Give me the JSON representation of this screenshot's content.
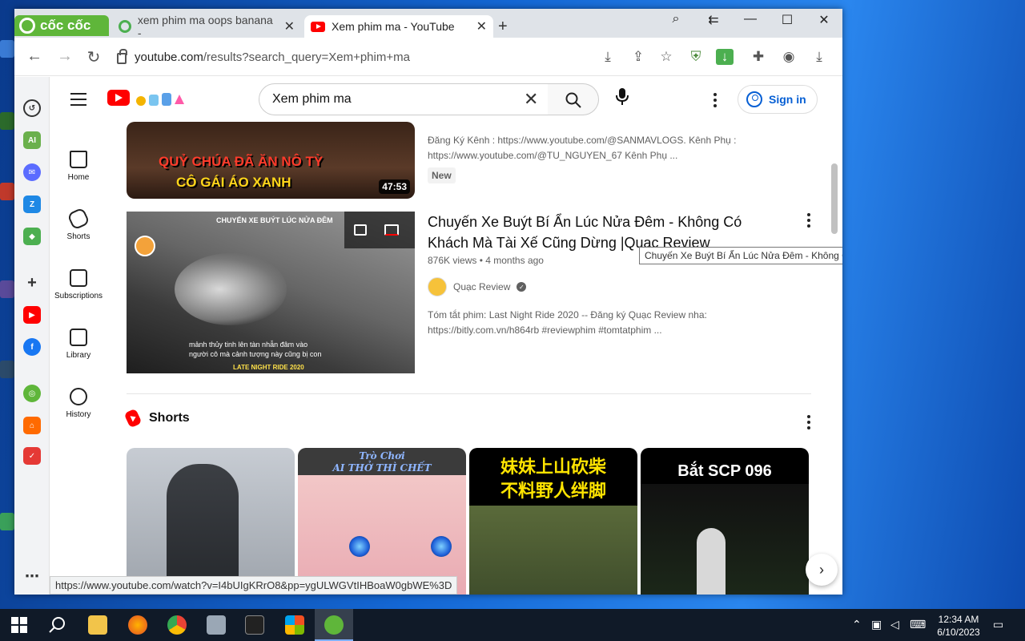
{
  "browser": {
    "brand": "cốc cốc",
    "tabs": [
      {
        "title": "xem phim ma oops banana -"
      },
      {
        "title": "Xem phim ma - YouTube"
      }
    ],
    "url_host": "youtube.com",
    "url_path": "/results?search_query=Xem+phim+ma",
    "status_url": "https://www.youtube.com/watch?v=I4bUIgKRrO8&pp=ygULWGVtIHBoaW0gbWE%3D"
  },
  "youtube": {
    "search_value": "Xem phim ma",
    "sign_in": "Sign in",
    "guide": [
      {
        "label": "Home"
      },
      {
        "label": "Shorts"
      },
      {
        "label": "Subscriptions"
      },
      {
        "label": "Library"
      },
      {
        "label": "History"
      }
    ],
    "result1": {
      "desc_line1": "Đăng Ký Kênh : https://www.youtube.com/@SANMAVLOGS. Kênh Phụ :",
      "desc_line2": "https://www.youtube.com/@TU_NGUYEN_67 Kênh Phụ ...",
      "badge": "New",
      "duration": "47:53",
      "thumb_text1": "QUỶ CHÚA ĐÃ ĂN NÔ TỲ",
      "thumb_text2": "CÔ GÁI ÁO XANH"
    },
    "result2": {
      "title": "Chuyến Xe Buýt Bí Ẩn Lúc Nửa Đêm - Không Có Khách Mà Tài Xế Cũng Dừng |Quạc Review",
      "views": "876K views",
      "age": "4 months ago",
      "channel": "Quạc Review",
      "desc_line1": "Tóm tắt phim: Last Night Ride 2020 -- Đăng ký Quạc Review nha:",
      "desc_line2": "https://bitly.com.vn/h864rb #reviewphim #tomtatphim ...",
      "tooltip": "Chuyến Xe Buýt Bí Ẩn Lúc Nửa Đêm - Không Có Khách Mà Tài Xế Cũng Dừng |Quạc Review|",
      "thumb_top": "CHUYẾN XE BUÝT LÚC NỬA ĐÊM",
      "thumb_sub1": "mảnh thủy tinh lên tàn nhẫn đâm vào",
      "thumb_sub2": "người cô mà cảnh tượng này cũng bị con",
      "thumb_sub3": "LATE NIGHT RIDE 2020"
    },
    "shorts": {
      "heading": "Shorts",
      "s2_cap1": "Trò Chơi",
      "s2_cap2": "AI THỞ THÌ CHẾT",
      "s3_cap1": "妹妹上山砍柴",
      "s3_cap2": "不料野人绊脚",
      "s4_cap": "Bắt SCP 096"
    }
  },
  "taskbar": {
    "time": "12:34 AM",
    "date": "6/10/2023"
  },
  "colors": {
    "youtube_red": "#ff0000",
    "coccoc_green": "#5fb63a",
    "link_blue": "#065fd4"
  }
}
